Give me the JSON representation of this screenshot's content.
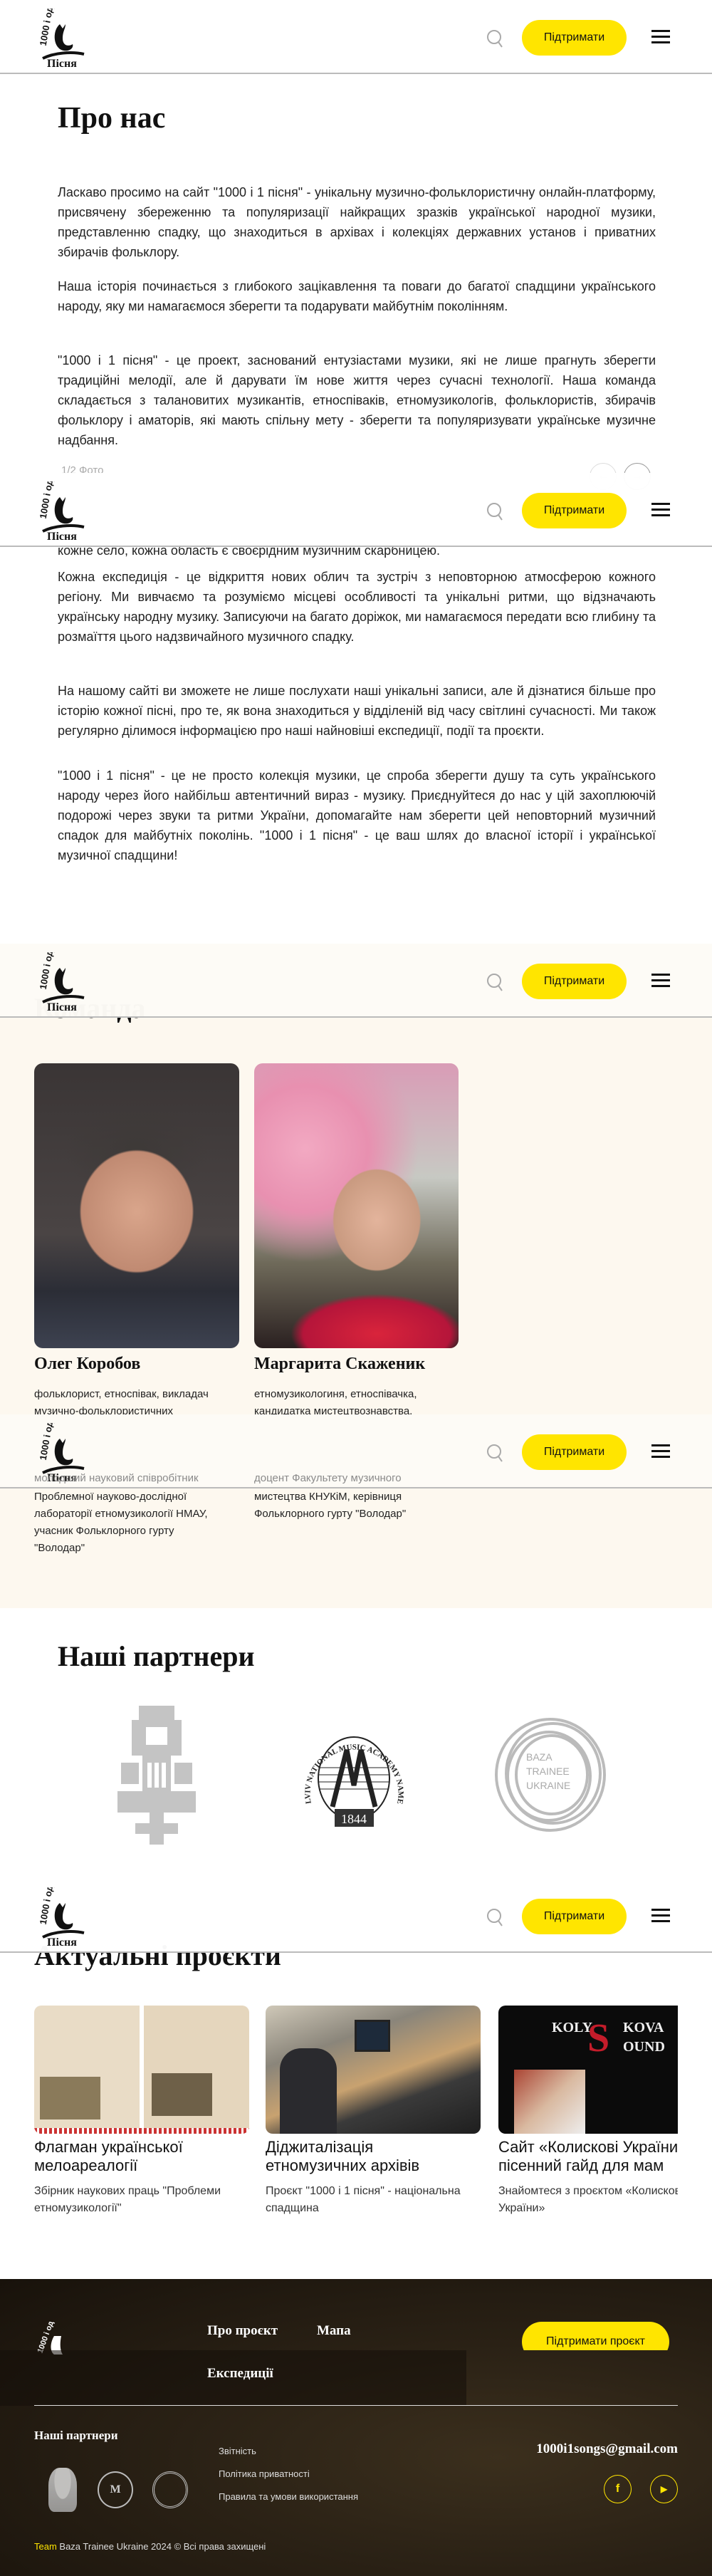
{
  "header": {
    "logo_text_top": "1000 і одна",
    "logo_text_bottom": "Пісня",
    "support_label": "Підтримати",
    "icons": {
      "search": "search-icon",
      "menu": "hamburger-menu-icon"
    }
  },
  "about": {
    "title": "Про нас",
    "paragraphs": [
      "Ласкаво просимо на сайт \"1000 і 1 пісня\" - унікальну музично-фольклористичну онлайн-платформу, присвячену збереженню та популяризації найкращих зразків української народної музики, представленню спадку, що знаходиться в архівах і колекціях державних установ і приватних збирачів фольклору.",
      "Наша історія починається з глибокого зацікавлення та поваги до багатої спадщини українського народу, яку ми намагаємося зберегти та подарувати майбутнім поколінням.",
      "\"1000 і 1 пісня\" - це проект, заснований ентузіастами музики, які не лише прагнуть зберегти традиційні мелодії, але й дарувати їм нове життя через сучасні технології. Наша команда складається з талановитих музикантів, етноспіваків, етномузикологів, фольклористів, збирачів фольклору і аматорів, які мають спільну мету - зберегти та популяризувати українське музичне надбання."
    ],
    "photo_counter": "1/2 Фото",
    "continued": [
      "кожне село, кожна область є своєрідним музичним скарбницею.",
      "Кожна експедиція - це відкриття нових облич та зустріч з неповторною атмосферою кожного регіону. Ми вивчаємо та розуміємо місцеві особливості та унікальні ритми, що відзначають українську народну музику. Записуючи на багато доріжок, ми намагаємося передати всю глибину та розмаїття цього надзвичайного музичного спадку.",
      "На нашому сайті ви зможете не лише послухати наші унікальні записи, але й дізнатися більше про історію кожної пісні, про те, як вона знаходиться у відділеній від часу світлині сучасності. Ми також регулярно ділимося інформацією про наші найновіші експедиції, події та проєкти.",
      "\"1000 і 1 пісня\" - це не просто колекція музики, це спроба зберегти душу та суть українського народу через його найбільш автентичний вираз - музику. Приєднуйтеся до нас у цій захоплюючій подорожі через звуки та ритми України, допомагайте нам зберегти цей неповторний музичний спадок для майбутніх поколінь. \"1000 і 1 пісня\" - це ваш шлях до власної історії і української музичної спадщини!"
    ]
  },
  "team": {
    "title": "Команда",
    "members": [
      {
        "name": "Олег Коробов",
        "role_lines": [
          "фольклорист, етноспівак, викладач",
          "музично-фольклористичних",
          "молодший науковий співробітник",
          "Проблемної науково-дослідної",
          "лабораторії етномузикології НМАУ,",
          "учасник Фольклорного гурту",
          "\"Володар\""
        ]
      },
      {
        "name": "Маргарита Скаженик",
        "role_lines": [
          "етномузикологиня, етноспівачка,",
          "кандидатка мистецтвознавства,",
          "доцент Факультету музичного",
          "мистецтва КНУКіМ, керівниця",
          "Фольклорного гурту \"Володар\""
        ]
      }
    ]
  },
  "partners": {
    "title": "Наші партнери",
    "logos": [
      {
        "name": "ornament-emblem"
      },
      {
        "name": "Lviv National Music Academy",
        "text": "LVIV NATIONAL MUSIC ACADEMY NAMED AFTER MYKOLA LYSENKO",
        "year": "1844"
      },
      {
        "name": "Baza Trainee Ukraine",
        "text": "BAZA TRAINEE UKRAINE"
      }
    ]
  },
  "projects": {
    "title": "Актуальні проєкти",
    "items": [
      {
        "title_lines": [
          "Флагман української",
          "мелоареалогії"
        ],
        "desc_lines": [
          "Збірник наукових праць \"Проблеми",
          "етномузикології\""
        ]
      },
      {
        "title_lines": [
          "Діджиталізація",
          "етномузичних архівів"
        ],
        "desc_lines": [
          "Проєкт \"1000 і 1 пісня\" - національна",
          "спадщина"
        ]
      },
      {
        "title_lines": [
          "Сайт «Колискові України",
          "пісенний гайд для мам"
        ],
        "desc_lines": [
          "Знайомтеся з проєктом «Колискові",
          "України»"
        ],
        "image_text": [
          "KOLY",
          "KOVA",
          "OUND"
        ]
      }
    ]
  },
  "footer": {
    "nav": [
      "Про проєкт",
      "Мапа",
      "Експедиції"
    ],
    "support_label": "Підтримати проєкт",
    "partners_title": "Наші партнери",
    "links": [
      "Звітність",
      "Політика приватності",
      "Правила та умови використання"
    ],
    "email": "1000i1songs@gmail.com",
    "social": [
      {
        "name": "facebook",
        "glyph": "f"
      },
      {
        "name": "youtube",
        "glyph": "▶"
      }
    ],
    "copyright_accent": "Team",
    "copyright": " Baza Trainee Ukraine 2024 © Всі права захищені"
  },
  "colors": {
    "accent": "#ffe500",
    "cream": "#fdf8ef",
    "footer": "#2a2115"
  }
}
